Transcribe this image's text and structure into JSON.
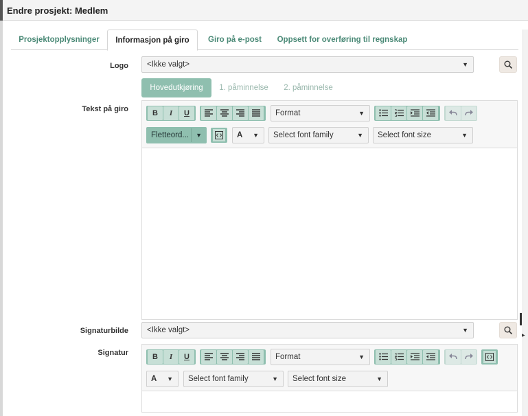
{
  "window": {
    "title": "Endre prosjekt: Medlem"
  },
  "tabs": [
    {
      "label": "Prosjektopplysninger"
    },
    {
      "label": "Informasjon på giro"
    },
    {
      "label": "Giro på e-post"
    },
    {
      "label": "Oppsett for overføring til regnskap"
    }
  ],
  "logo": {
    "label": "Logo",
    "value": "<Ikke valgt>"
  },
  "subtabs": [
    {
      "label": "Hovedutkjøring"
    },
    {
      "label": "1. påminnelse"
    },
    {
      "label": "2. påminnelse"
    }
  ],
  "tekst": {
    "label": "Tekst på giro",
    "format": "Format",
    "fletteord": "Fletteord...",
    "font_color": "A",
    "font_family": "Select font family",
    "font_size": "Select font size"
  },
  "signaturbilde": {
    "label": "Signaturbilde",
    "value": "<Ikke valgt>"
  },
  "signatur": {
    "label": "Signatur",
    "format": "Format",
    "font_color": "A",
    "font_family": "Select font family",
    "font_size": "Select font size"
  },
  "buttons": {
    "bold": "B",
    "italic": "I",
    "underline": "U"
  },
  "colors": {
    "accent": "#8fbfaf",
    "tab_text": "#4b8a77"
  }
}
